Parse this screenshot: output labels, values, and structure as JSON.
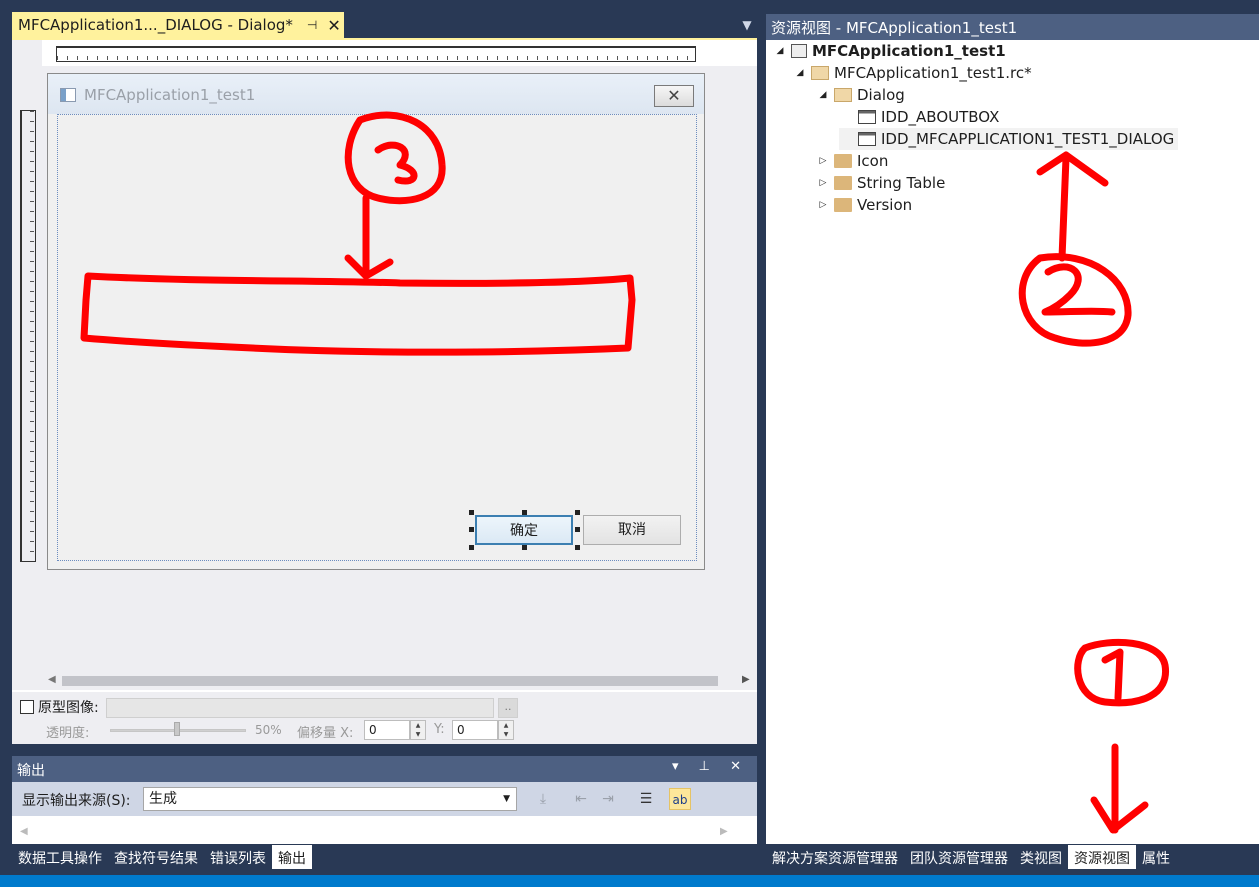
{
  "editor": {
    "tab_title": "MFCApplication1..._DIALOG - Dialog*",
    "pin_glyph": "⊣",
    "close_glyph": "✕",
    "dropdown_glyph": "▼"
  },
  "dialog": {
    "title": "MFCApplication1_test1",
    "close_glyph": "✕",
    "ok_label": "确定",
    "cancel_label": "取消"
  },
  "prototype": {
    "label": "原型图像:",
    "browse_label": "..",
    "opacity_label": "透明度:",
    "opacity_value": "50%",
    "offset_label": "偏移量 X:",
    "x_value": "0",
    "y_label": "Y:",
    "y_value": "0"
  },
  "output": {
    "title": "输出",
    "header_icons": "▾ ⊥ ✕",
    "source_label": "显示输出来源(S):",
    "source_value": "生成"
  },
  "bottom_tabs_left": [
    "数据工具操作",
    "查找符号结果",
    "错误列表",
    "输出"
  ],
  "bottom_tabs_left_active": 3,
  "resource_view": {
    "header": "资源视图 - MFCApplication1_test1",
    "project": "MFCApplication1_test1",
    "rc_file": "MFCApplication1_test1.rc*",
    "dialog_folder": "Dialog",
    "aboutbox": "IDD_ABOUTBOX",
    "main_dialog": "IDD_MFCAPPLICATION1_TEST1_DIALOG",
    "icon_folder": "Icon",
    "string_table": "String Table",
    "version": "Version"
  },
  "bottom_tabs_right": [
    "解决方案资源管理器",
    "团队资源管理器",
    "类视图",
    "资源视图",
    "属性"
  ],
  "bottom_tabs_right_active": 3,
  "colors": {
    "chrome": "#293955",
    "tab_active": "#fff29d",
    "panel_header": "#4d6082",
    "annotation": "#ff0000",
    "status": "#007acc"
  }
}
